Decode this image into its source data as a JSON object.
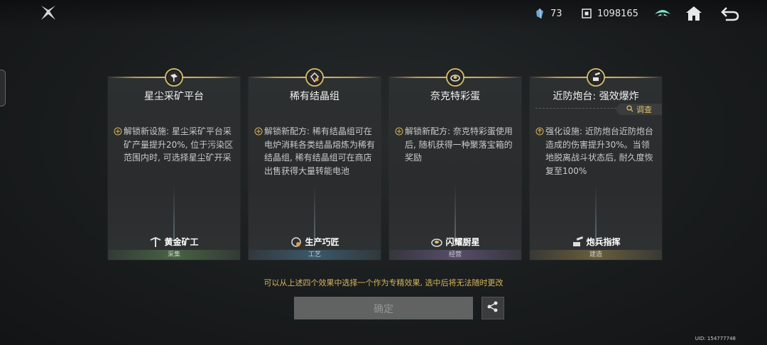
{
  "header": {
    "resource_a_value": "73",
    "resource_b_value": "1098165"
  },
  "cards": [
    {
      "title": "星尘采矿平台",
      "description": "解锁新设施: 星尘采矿平台采矿产量提升20%, 位于污染区范围内时, 可选择星尘矿开采",
      "role": "黄金矿工",
      "category": "采集"
    },
    {
      "title": "稀有结晶组",
      "description": "解锁新配方: 稀有结晶组可在电炉消耗各类结晶熔炼为稀有结晶组, 稀有结晶组可在商店出售获得大量转能电池",
      "role": "生产巧匠",
      "category": "工艺"
    },
    {
      "title": "奈克特彩蛋",
      "description": "解锁新配方: 奈克特彩蛋使用后, 随机获得一种聚落宝箱的奖励",
      "role": "闪耀厨星",
      "category": "经营"
    },
    {
      "title": "近防炮台: 强效爆炸",
      "description": "强化设施: 近防炮台近防炮台造成的伤害提升30%。当领地脱离战斗状态后, 耐久度恢复至100%",
      "role": "炮兵指挥",
      "category": "建造",
      "inspect_label": "调查"
    }
  ],
  "hint": "可以从上述四个效果中选择一个作为专精效果, 选中后将无法随时更改",
  "confirm_label": "确定",
  "uid": "UID: 154777748",
  "colors": {
    "accent_gold": "#d6b45a",
    "card_bg": "#2d3031"
  }
}
